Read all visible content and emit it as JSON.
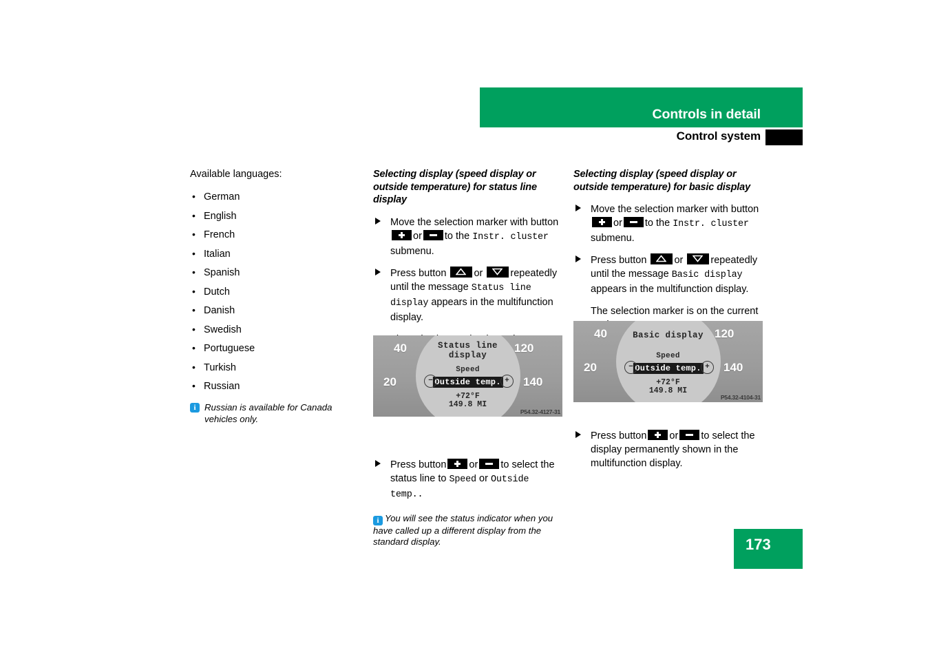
{
  "header": {
    "title": "Controls in detail",
    "subtitle": "Control system",
    "green": "#00a05e"
  },
  "left_column": {
    "heading": "Available languages:",
    "languages": [
      "German",
      "English",
      "French",
      "Italian",
      "Spanish",
      "Dutch",
      "Danish",
      "Swedish",
      "Portuguese",
      "Turkish",
      "Russian"
    ],
    "note": "Russian is available for Canada vehicles only.",
    "info_icon": "info-icon"
  },
  "middle_column": {
    "heading": "Selecting display (speed display or outside temperature) for status line display",
    "step1": {
      "text_a": "Move the selection marker with button",
      "text_or": "or",
      "text_b": "to the",
      "mono_a": "Instr. cluster",
      "text_c": "submenu.",
      "button_plus": "plus-button",
      "button_minus": "minus-button"
    },
    "step2": {
      "text_a": "Press button",
      "text_or": "or",
      "text_b": "repeatedly until the message",
      "mono_a": "Status line display",
      "text_c": "appears in the multifunction display.",
      "button_up": "up-button",
      "button_down": "down-button"
    },
    "para1": "The selection marker is on the current setting.",
    "step3": {
      "text_a": "Press button",
      "text_or": "or",
      "text_b": "to select the status line to",
      "mono_a": "Speed",
      "text_mid": "or",
      "mono_b": "Outside temp..",
      "button_plus": "plus-button",
      "button_minus": "minus-button"
    },
    "note": "You will see the status indicator when you have called up a different display from the standard display."
  },
  "right_column": {
    "heading": "Selecting display (speed display or outside temperature) for basic display",
    "step1": {
      "text_a": "Move the selection marker with button",
      "text_or": "or",
      "text_b": "to the",
      "mono_a": "Instr. cluster",
      "text_c": "submenu.",
      "button_plus": "plus-button",
      "button_minus": "minus-button"
    },
    "step2": {
      "text_a": "Press button",
      "text_or": "or",
      "text_b": "repeatedly until the message",
      "mono_a": "Basic display",
      "text_c": "appears in the multifunction display.",
      "button_up": "up-button",
      "button_down": "down-button"
    },
    "para1": "The selection marker is on the current setting.",
    "step3": {
      "text_a": "Press button",
      "text_or": "or",
      "text_b": "to select the display permanently shown in the multifunction display.",
      "button_plus": "plus-button",
      "button_minus": "minus-button"
    }
  },
  "figure_status_line": {
    "title_line1": "Status line",
    "title_line2": "display",
    "option_unselected": "Speed",
    "option_selected": "Outside temp.",
    "temperature": "+72°F",
    "odometer": "149.8 MI",
    "minus_glyph": "−",
    "plus_glyph": "+",
    "speed_marks": [
      "20",
      "40",
      "120",
      "140"
    ],
    "code": "P54.32-4127-31"
  },
  "figure_basic_display": {
    "title_line1": "Basic display",
    "title_line2": "",
    "option_unselected": "Speed",
    "option_selected": "Outside temp.",
    "temperature": "+72°F",
    "odometer": "149.8 MI",
    "minus_glyph": "−",
    "plus_glyph": "+",
    "speed_marks": [
      "20",
      "40",
      "120",
      "140"
    ],
    "code": "P54.32-4104-31"
  },
  "footer": {
    "page_number": "173"
  }
}
